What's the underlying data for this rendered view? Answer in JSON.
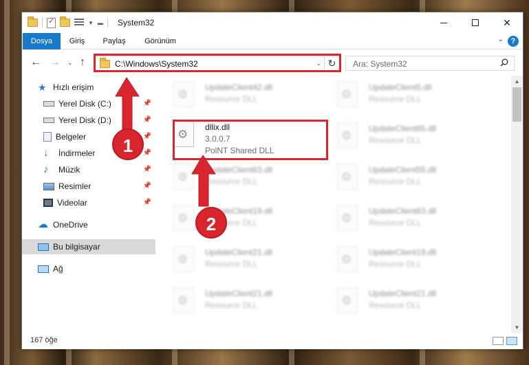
{
  "window": {
    "title": "System32"
  },
  "ribbon": {
    "tabs": [
      "Dosya",
      "Giriş",
      "Paylaş",
      "Görünüm"
    ]
  },
  "address": {
    "path": "C:\\Windows\\System32"
  },
  "search": {
    "placeholder": "Ara: System32"
  },
  "sidebar": {
    "quick_access": "Hızlı erişim",
    "items": [
      {
        "label": "Yerel Disk (C:)",
        "icon": "drive-icon",
        "pinned": true
      },
      {
        "label": "Yerel Disk (D:)",
        "icon": "drive-icon",
        "pinned": true
      },
      {
        "label": "Belgeler",
        "icon": "documents-icon",
        "pinned": true
      },
      {
        "label": "İndirmeler",
        "icon": "downloads-icon",
        "pinned": true
      },
      {
        "label": "Müzik",
        "icon": "music-icon",
        "pinned": true
      },
      {
        "label": "Resimler",
        "icon": "pictures-icon",
        "pinned": true
      },
      {
        "label": "Videolar",
        "icon": "videos-icon",
        "pinned": true
      }
    ],
    "onedrive": "OneDrive",
    "this_pc": "Bu bilgisayar",
    "network": "Ağ"
  },
  "files": {
    "highlighted": {
      "name": "dllix.dll",
      "version": "3.0.0.7",
      "description": "PolNT Shared DLL"
    },
    "left_column": [
      {
        "name": "UpdateClient42.dll",
        "type": "Resource DLL"
      },
      {
        "name": "UpdateClient63.dll",
        "type": "Resource DLL"
      },
      {
        "name": "UpdateClient19.dll",
        "type": "Resource DLL"
      },
      {
        "name": "UpdateClient21.dll",
        "type": "Resource DLL"
      },
      {
        "name": "UpdateClient21.dll",
        "type": "Resource DLL"
      }
    ],
    "right_column": [
      {
        "name": "UpdateClient5.dll",
        "type": "Resource DLL"
      },
      {
        "name": "UpdateClient65.dll",
        "type": "Resource DLL"
      },
      {
        "name": "UpdateClient55.dll",
        "type": "Resource DLL"
      },
      {
        "name": "UpdateClient63.dll",
        "type": "Resource DLL"
      },
      {
        "name": "UpdateClient19.dll",
        "type": "Resource DLL"
      },
      {
        "name": "UpdateClient21.dll",
        "type": "Resource DLL"
      }
    ]
  },
  "status": {
    "count": "167 öğe"
  },
  "annotations": {
    "marker1": "1",
    "marker2": "2",
    "color": "#d9262e"
  },
  "colors": {
    "accent": "#1979ca",
    "highlight": "#d9262e"
  }
}
